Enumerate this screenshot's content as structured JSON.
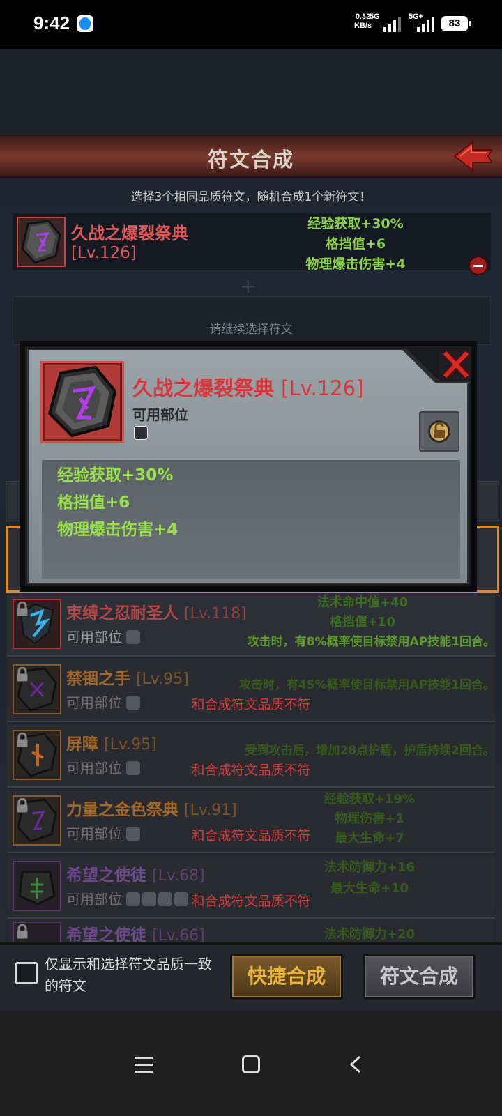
{
  "status_bar": {
    "time": "9:42",
    "net_speed_value": "0.32",
    "net_speed_unit": "KB/s",
    "net_type": "5G",
    "second_net": "5G+",
    "battery": "83",
    "app_icon": "qq-penguin-icon"
  },
  "header": {
    "title": "符文合成",
    "back_icon": "red-arrow-back-icon"
  },
  "instruction": "选择3个相同品质符文，随机合成1个新符文！",
  "selected_rune": {
    "name": "久战之爆裂祭典",
    "level": "[Lv.126]",
    "stats": [
      "经验获取+30%",
      "格挡值+6",
      "物理爆击伤害+4"
    ],
    "remove_icon": "minus-circle-icon"
  },
  "continue_prompt": "请继续选择符文",
  "popup": {
    "name": "久战之爆裂祭典",
    "level": "[Lv.126]",
    "part_label": "可用部位",
    "stats": [
      "经验获取+30%",
      "格挡值+6",
      "物理爆击伤害+4"
    ],
    "close_icon": "close-x-icon",
    "lock_icon": "unlock-icon"
  },
  "rune_list": [
    {
      "name": "束缚之忍耐圣人",
      "level": "[Lv.118]",
      "part_label": "可用部位",
      "stats": [
        "法术命中值+40",
        "格挡值+10"
      ],
      "effect": "攻击时，有8%概率使目标禁用AP技能1回合。",
      "mismatch": ""
    },
    {
      "name": "禁锢之手",
      "level": "[Lv.95]",
      "part_label": "可用部位",
      "stats": [],
      "effect": "攻击时，有45%概率使目标禁用AP技能1回合。",
      "mismatch": "和合成符文品质不符"
    },
    {
      "name": "屏障",
      "level": "[Lv.95]",
      "part_label": "可用部位",
      "stats": [],
      "effect": "受到攻击后，增加28点护盾，护盾持续2回合。",
      "mismatch": "和合成符文品质不符"
    },
    {
      "name": "力量之金色祭典",
      "level": "[Lv.91]",
      "part_label": "可用部位",
      "stats": [
        "经验获取+19%",
        "物理伤害+1",
        "最大生命+7"
      ],
      "effect": "",
      "mismatch": "和合成符文品质不符"
    },
    {
      "name": "希望之使徒",
      "level": "[Lv.68]",
      "part_label": "可用部位",
      "stats": [
        "法术防御力+16",
        "最大生命+10"
      ],
      "effect": "",
      "mismatch": "和合成符文品质不符"
    },
    {
      "name": "希望之使徒",
      "level": "[Lv.66]",
      "part_label": "",
      "stats": [
        "法术防御力+20"
      ],
      "effect": "",
      "mismatch": ""
    }
  ],
  "bottom_bar": {
    "filter_label": "仅显示和选择符文品质一致的符文",
    "filter_checked": false,
    "quick_button": "快捷合成",
    "compose_button": "符文合成"
  },
  "colors": {
    "legendary_red": "#e05858",
    "epic_orange": "#c87830",
    "rare_purple": "#8a5aaa",
    "stat_green": "#8bcf4a",
    "mismatch_red": "#d23c3c"
  }
}
